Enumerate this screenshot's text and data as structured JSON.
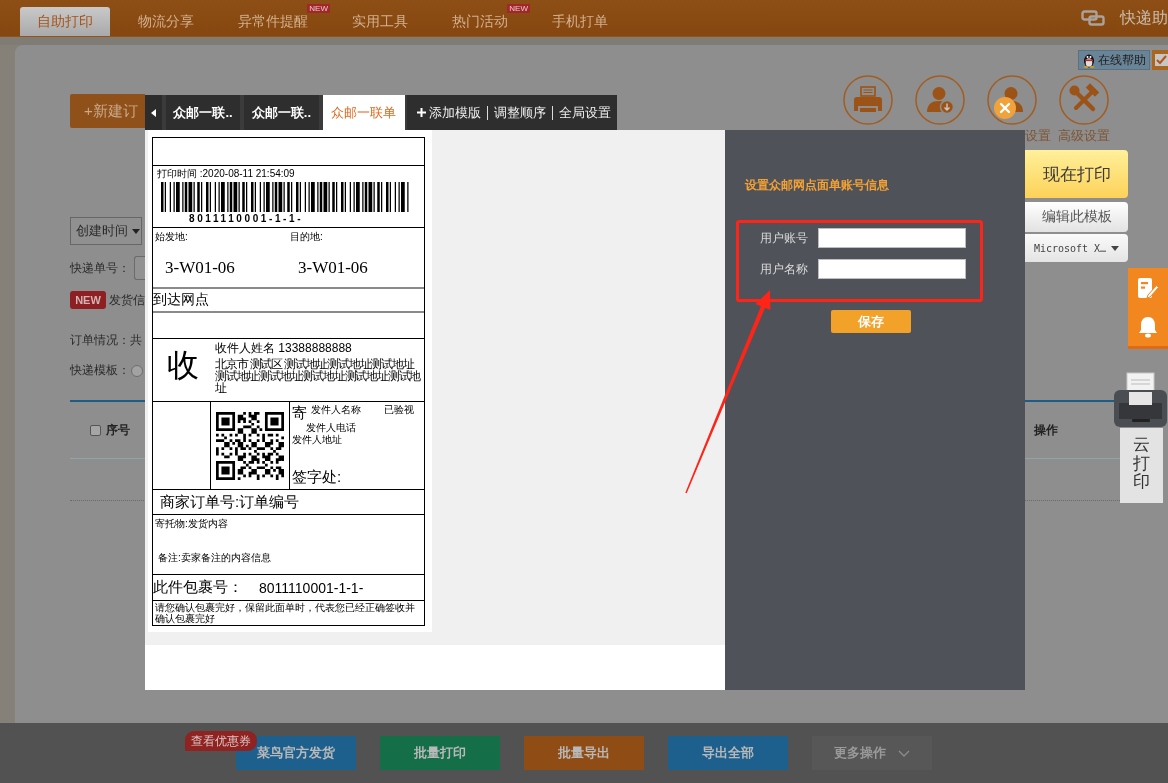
{
  "top_nav": {
    "tabs": [
      {
        "label": "自助打印",
        "selected": true
      },
      {
        "label": "物流分享",
        "selected": false
      },
      {
        "label": "异常件提醒",
        "selected": false,
        "badge": "NEW"
      },
      {
        "label": "实用工具",
        "selected": false
      },
      {
        "label": "热门活动",
        "selected": false,
        "badge": "NEW"
      },
      {
        "label": "手机打单",
        "selected": false
      }
    ],
    "brand": "快递助"
  },
  "toolbar": {
    "new_order_button": "+新建订",
    "help_button": "在线帮助",
    "tool_icons": [
      {
        "kind": "printer"
      },
      {
        "kind": "user-download"
      },
      {
        "kind": "user",
        "label": "设置",
        "label_clipped": true
      },
      {
        "kind": "tools",
        "label": "高级设置"
      }
    ]
  },
  "filters": {
    "sort_select": "创建时间",
    "tracking_label": "快递单号：",
    "notice_badge": "NEW",
    "notice_text": "发货信",
    "order_summary": "订单情况：共",
    "template_label": "快递模板：",
    "template_radio": {
      "checked": false
    }
  },
  "table": {
    "select_all": {
      "checked": false
    },
    "columns": [
      {
        "label": "序号"
      },
      {
        "label": "操作"
      }
    ]
  },
  "print_dialog": {
    "tabs": [
      {
        "label": "众邮一联..",
        "selected": false
      },
      {
        "label": "众邮一联..",
        "selected": false
      },
      {
        "label": "众邮一联单",
        "selected": true
      }
    ],
    "tab_actions": [
      {
        "label": "添加模版",
        "kind": "add"
      },
      {
        "label": "调整顺序",
        "kind": "link"
      },
      {
        "label": "全局设置",
        "kind": "link"
      }
    ],
    "label_preview": {
      "print_time": "打印时间 :2020-08-11 21:54:09",
      "barcode_number": "8011110001-1-1-",
      "origin_label": "始发地:",
      "destination_label": "目的地:",
      "origin_code": "3-W01-06",
      "destination_code": "3-W01-06",
      "arrival_outlet": "到达网点",
      "recipient_mark": "收",
      "recipient": "收件人姓名 13388888888",
      "recipient_address": "北京市 测试区 测试地址测试地址测试地址测试地址测试地址测试地址测试地址测试地址",
      "sender_mark": "寄",
      "sender_name": "发件人名称",
      "inspected": "已验视",
      "sender_phone": "发件人电话",
      "sender_address": "发件人地址",
      "signature": "签字处:",
      "merchant_order": "商家订单号:订单编号",
      "contents": "寄托物:发货内容",
      "remark": "备注:卖家备注的内容信息",
      "package_label": "此件包裹号：",
      "package_number": "8011110001-1-1-",
      "notice": "请您确认包裹完好，保留此面单时，代表您已经正确签收并确认包裹完好"
    },
    "account_form": {
      "title": "设置众邮网点面单账号信息",
      "highlighted": true,
      "pointer_arrow": true,
      "fields": [
        {
          "label": "用户账号"
        },
        {
          "label": "用户名称"
        }
      ],
      "save_button": "保存"
    },
    "print_button": "现在打印",
    "edit_template_button": "编辑此模板",
    "printer_select": "Microsoft X…"
  },
  "side_widgets": {
    "cloud_print": "云打印"
  },
  "bottom_bar": {
    "coupon_badge": "查看优惠券",
    "buttons": [
      {
        "label": "菜鸟官方发货",
        "kind": "button",
        "color": "#1d5f8d"
      },
      {
        "label": "批量打印",
        "kind": "button",
        "color": "#146f49"
      },
      {
        "label": "批量导出",
        "kind": "button",
        "color": "#8f4d15"
      },
      {
        "label": "导出全部",
        "kind": "button",
        "color": "#1d5f8d"
      },
      {
        "label": "更多操作",
        "kind": "dropdown",
        "color": "#575757"
      }
    ]
  }
}
